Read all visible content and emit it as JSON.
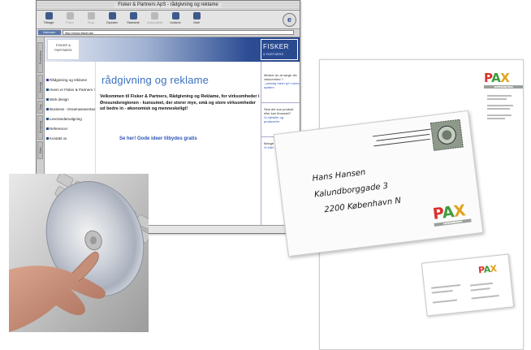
{
  "browser": {
    "window_title": "Fisker & Partners ApS - rådgivning og reklame",
    "toolbar_buttons": [
      {
        "label": "Tilbage",
        "enabled": true
      },
      {
        "label": "Frem",
        "enabled": false
      },
      {
        "label": "Stop",
        "enabled": false
      },
      {
        "label": "Opdater",
        "enabled": true
      },
      {
        "label": "Startside",
        "enabled": true
      },
      {
        "label": "Autoudfyld",
        "enabled": false
      },
      {
        "label": "Udskriv",
        "enabled": true
      },
      {
        "label": "Mail",
        "enabled": true
      }
    ],
    "address_label": "Adresse:",
    "address_value": "http://www.fisker.dk/",
    "side_tabs": [
      "Foretrukne",
      "Oversigt",
      "Søg",
      "Scrapbog",
      "Sider"
    ]
  },
  "site": {
    "logo_text": "FISKER & PARTNERS",
    "brand_box": {
      "name": "FISKER",
      "sub": "& PARTNERS"
    },
    "nav_items": [
      "Rådgivning og reklame",
      "Hvem er Fisker & Partners ?",
      "Web design",
      "Business - Dreamweaverteam",
      "Leverandørvalgning",
      "Referencer",
      "Kontakt os"
    ],
    "headline": "rådgivning og reklame",
    "welcome": "Velkommen til Fisker & Partners, Rådgivning og Reklame, for virksomheder i Øresundsregionen - kunsumet, der storer mye, små og store virksomheder ud bedre in - økonomisk og menneskeligt!",
    "cta": "Se her! Gode ideer tilbydes gratis",
    "right_blocks": [
      {
        "text": "Ønsker du at sørge din virksomhed ?",
        "link": "- pressig med nyt i vores system"
      },
      {
        "text": "Skal det kun produkt eller kan finansiel?",
        "link": "Vi udvikler og producerer"
      },
      {
        "text": "Mange du har",
        "link": "Vi eller hvor og om"
      }
    ]
  },
  "envelope": {
    "recipient_lines": [
      "Hans Hansen",
      "Kalundborggade 3",
      "2200 København N"
    ]
  },
  "branding": {
    "logo_letters": [
      "P",
      "A",
      "X"
    ],
    "logo_sub": "KOMMUNIKATION",
    "colors": {
      "p": "#d8322b",
      "a": "#3f9c3a",
      "x": "#e2a21b",
      "link_blue": "#2b55b8",
      "banner_blue": "#2a4a90"
    }
  }
}
